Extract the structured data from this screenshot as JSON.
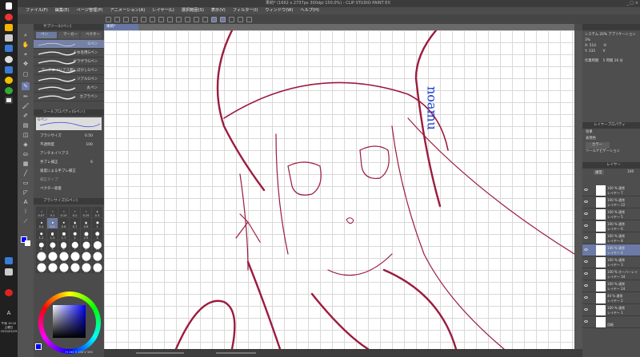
{
  "window": {
    "title": "果莉* (1692 x 2737px 300dpi 150.0%) - CLIP STUDIO PAINT EX",
    "controls": [
      "_",
      "□",
      "×"
    ]
  },
  "menu": [
    "ファイル(F)",
    "編集(E)",
    "ページ管理(P)",
    "アニメーション(A)",
    "レイヤー(L)",
    "選択範囲(S)",
    "表示(V)",
    "フィルター(I)",
    "ウィンドウ(W)",
    "ヘルプ(H)"
  ],
  "subtool": {
    "panel_title": "サブツール[ペン]",
    "tabs": [
      "ペン",
      "マーカー",
      "ベクター"
    ],
    "brushes": [
      {
        "label": "Gペン",
        "selected": true
      },
      {
        "label": "まゆ毛用Gペン"
      },
      {
        "label": "ザラザラGペン"
      },
      {
        "label": "アンチエイリアス無しぼかしGペン"
      },
      {
        "label": "リアルGペン"
      },
      {
        "label": "丸ペン"
      },
      {
        "label": "カブラペン"
      }
    ]
  },
  "tool_property": {
    "panel_title": "ツールプロパティ[Gペン]",
    "preview_label": "Gペン",
    "brush_size_label": "ブラシサイズ",
    "brush_size": "0.50",
    "opacity_label": "不透明度",
    "opacity": "100",
    "antialias_label": "アンチエイリアス",
    "stabilization_label": "手ブレ補正",
    "stabilization": "6",
    "speed_stab_label": "速度による手ブレ補正",
    "correction_type_label": "補正タイプ",
    "vector_snap_label": "ベクター吸着"
  },
  "brush_size_panel": {
    "title": "ブラシサイズ[Gペン]",
    "sizes": [
      "0.07",
      "0.1",
      "0.15",
      "0.2",
      "0.25",
      "0.3",
      "0.4",
      "0.5",
      "0.6",
      "0.7",
      "0.8",
      "1",
      "1.2",
      "1.5",
      "1.7",
      "2",
      "2.5",
      "3",
      "4",
      "5",
      "6",
      "7",
      "8",
      "10",
      "12",
      "15",
      "17",
      "20",
      "25",
      "30",
      "40",
      "50",
      "60",
      "70",
      "80",
      "100"
    ],
    "selected": "0.5"
  },
  "color": {
    "main": "#0000ff",
    "sub": "#ffffff",
    "hsv": "H 240  S 100  V 100"
  },
  "document_tab": "果莉*",
  "canvas": {
    "signature": "noamu",
    "line_color": "#9b1b3e",
    "signature_color": "#1f3fd0"
  },
  "navigator": {
    "system_label": "システム 20%",
    "app_label": "アプリケーション 3%",
    "x": "X: 514",
    "y": "Y: 335",
    "h": "H",
    "v": "V",
    "work_time_label": "作業時間",
    "work_time": "5 時間 26 分"
  },
  "layer_property": {
    "title": "レイヤープロパティ",
    "effect_label": "効果",
    "expression_label": "表現色",
    "expression_value": "カラー",
    "tool_nav_label": "ツールナビゲーション"
  },
  "layers_panel": {
    "title": "レイヤー",
    "blend": "通常",
    "opacity": "100",
    "layers": [
      {
        "info": "100 % 通常",
        "name": "レイヤー 7"
      },
      {
        "info": "100 % 通常",
        "name": "レイヤー 22"
      },
      {
        "info": "100 % 通常",
        "name": "レイヤー 5"
      },
      {
        "info": "100 % 通常",
        "name": "レイヤー 6"
      },
      {
        "info": "100 % 通常",
        "name": "レイヤー 8"
      },
      {
        "info": "100 % 通常",
        "name": "レイヤー 4",
        "selected": true
      },
      {
        "info": "100 % 通常",
        "name": "レイヤー 3"
      },
      {
        "info": "100 % オーバーレイ",
        "name": "レイヤー 34"
      },
      {
        "info": "100 % 通常",
        "name": "レイヤー 24"
      },
      {
        "info": "44 % 通常",
        "name": "レイヤー 2"
      },
      {
        "info": "100 % 通常",
        "name": "レイヤー 1"
      },
      {
        "info": "",
        "name": "用紙"
      }
    ]
  },
  "taskbar": {
    "time": "午後 10:10",
    "day": "土曜日",
    "date": "2025/03/29",
    "ime": "A"
  }
}
